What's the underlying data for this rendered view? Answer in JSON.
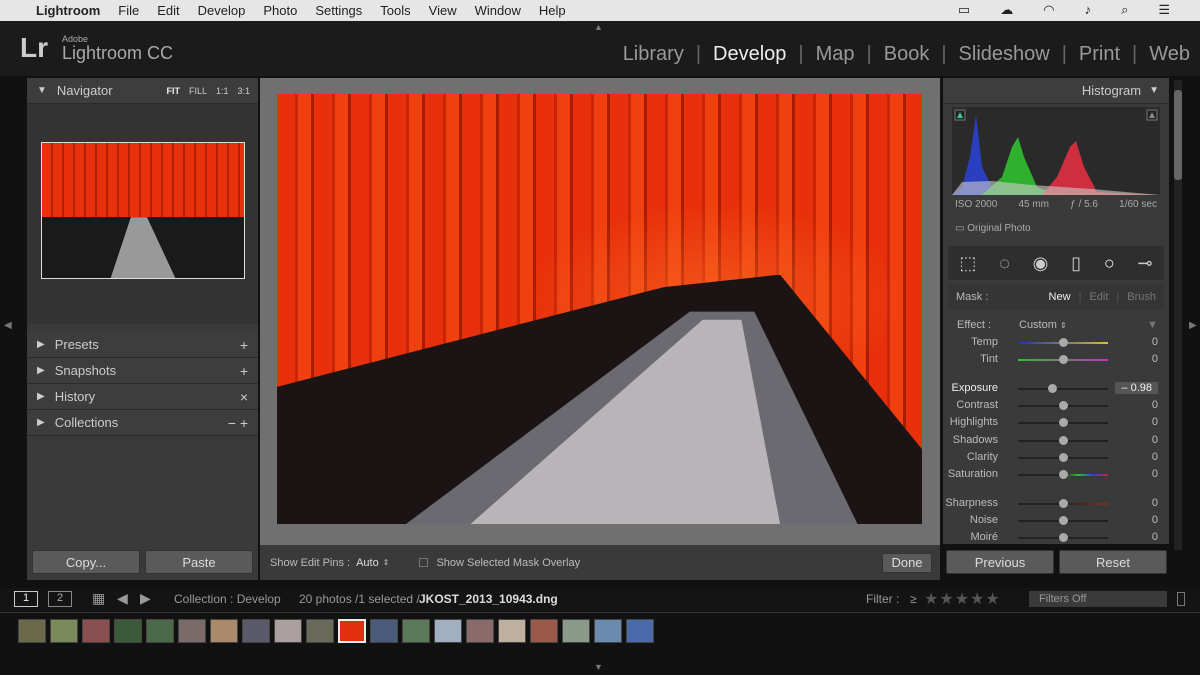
{
  "menubar": {
    "app": "Lightroom",
    "items": [
      "File",
      "Edit",
      "Develop",
      "Photo",
      "Settings",
      "Tools",
      "View",
      "Window",
      "Help"
    ]
  },
  "header": {
    "brand_small": "Adobe",
    "brand": "Lightroom CC",
    "logo": "Lr",
    "modules": [
      "Library",
      "Develop",
      "Map",
      "Book",
      "Slideshow",
      "Print",
      "Web"
    ],
    "active_module": "Develop"
  },
  "left": {
    "navigator": {
      "title": "Navigator",
      "zoom": [
        "FIT",
        "FILL",
        "1:1",
        "3:1"
      ]
    },
    "panels": [
      {
        "label": "Presets",
        "action": "+"
      },
      {
        "label": "Snapshots",
        "action": "+"
      },
      {
        "label": "History",
        "action": "×"
      },
      {
        "label": "Collections",
        "action": "−  +"
      }
    ],
    "copy": "Copy...",
    "paste": "Paste"
  },
  "toolbar": {
    "edit_pins_label": "Show Edit Pins :",
    "edit_pins_value": "Auto",
    "mask_overlay": "Show Selected Mask Overlay",
    "done": "Done"
  },
  "right": {
    "histogram": {
      "title": "Histogram",
      "iso": "ISO 2000",
      "focal": "45 mm",
      "aperture": "ƒ / 5.6",
      "shutter": "1/60 sec",
      "original": "Original Photo"
    },
    "mask": {
      "label": "Mask :",
      "new": "New",
      "edit": "Edit",
      "brush": "Brush"
    },
    "effect": {
      "label": "Effect :",
      "value": "Custom"
    },
    "sliders": [
      {
        "label": "Temp",
        "value": "0",
        "pos": 0.5
      },
      {
        "label": "Tint",
        "value": "0",
        "pos": 0.5
      },
      {
        "label": "Exposure",
        "value": "– 0.98",
        "pos": 0.38
      },
      {
        "label": "Contrast",
        "value": "0",
        "pos": 0.5
      },
      {
        "label": "Highlights",
        "value": "0",
        "pos": 0.5
      },
      {
        "label": "Shadows",
        "value": "0",
        "pos": 0.5
      },
      {
        "label": "Clarity",
        "value": "0",
        "pos": 0.5
      },
      {
        "label": "Saturation",
        "value": "0",
        "pos": 0.5
      },
      {
        "label": "Sharpness",
        "value": "0",
        "pos": 0.5
      },
      {
        "label": "Noise",
        "value": "0",
        "pos": 0.5
      },
      {
        "label": "Moiré",
        "value": "0",
        "pos": 0.5
      }
    ],
    "previous": "Previous",
    "reset": "Reset"
  },
  "filmstrip": {
    "view1": "1",
    "view2": "2",
    "collection": "Collection : Develop",
    "count": "20 photos /1 selected /",
    "filename": "JKOST_2013_10943.dng",
    "filter_label": "Filter :",
    "filter_op": "≥",
    "stars": "★★★★★",
    "filters_off": "Filters Off",
    "thumb_colors": [
      "#6a6a4a",
      "#7a8a5a",
      "#8a5050",
      "#3a5a3a",
      "#4a6a4a",
      "#7a6a6a",
      "#aa8a6a",
      "#5a5a6a",
      "#aaa0a0",
      "#6a6a5a",
      "#e03010",
      "#4a5a7a",
      "#5a7a5a",
      "#a0b0c0",
      "#8a6a6a",
      "#c0b0a0",
      "#9a5a4a",
      "#8a9a8a",
      "#6a8ab0",
      "#4a6aaa"
    ]
  }
}
